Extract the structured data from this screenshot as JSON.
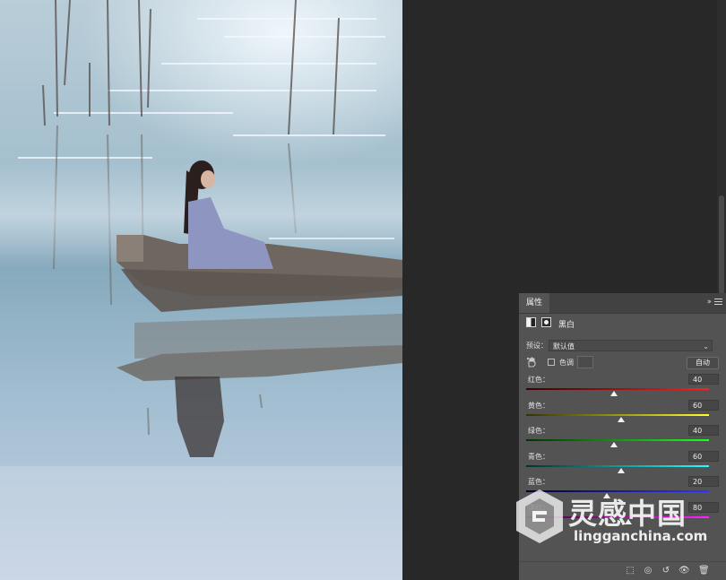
{
  "panel": {
    "tab_label": "属性",
    "adjustment_title": "黑白",
    "preset_label": "预设：",
    "preset_value": "默认值",
    "tint_label": "色调",
    "auto_label": "自动",
    "tint_checked": false
  },
  "sliders": [
    {
      "label": "红色：",
      "value": "40",
      "level": 40,
      "gradient": "linear-gradient(90deg,#3b0000,#ff2020)"
    },
    {
      "label": "黄色：",
      "value": "60",
      "level": 60,
      "gradient": "linear-gradient(90deg,#333300,#ffff2a)"
    },
    {
      "label": "绿色：",
      "value": "40",
      "level": 40,
      "gradient": "linear-gradient(90deg,#003300,#22ff22)"
    },
    {
      "label": "青色：",
      "value": "60",
      "level": 60,
      "gradient": "linear-gradient(90deg,#003333,#22ffff)"
    },
    {
      "label": "蓝色：",
      "value": "20",
      "level": 20,
      "gradient": "linear-gradient(90deg,#00002a,#3333ff)"
    },
    {
      "label": "洋红：",
      "value": "80",
      "level": 80,
      "gradient": "linear-gradient(90deg,#330033,#ff22ff)"
    }
  ],
  "slider_range": [
    -200,
    300
  ],
  "footer_icons": [
    "clip-to-layer-icon",
    "view-previous-state-icon",
    "reset-icon",
    "visibility-eye-icon",
    "trash-icon"
  ],
  "watermark": {
    "text": "灵感中国",
    "url": "lingganchina.com"
  }
}
